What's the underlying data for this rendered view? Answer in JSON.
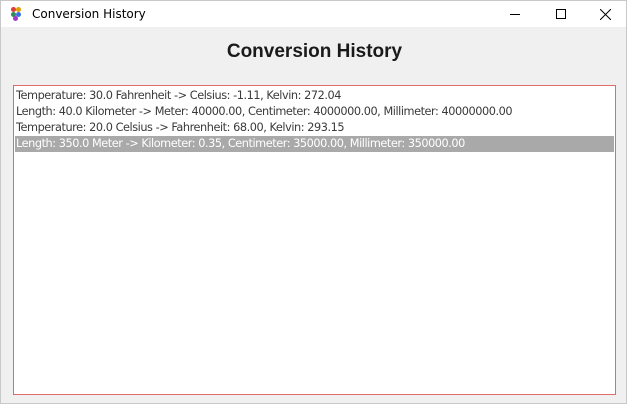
{
  "window": {
    "title": "Conversion History",
    "controls": {
      "minimize_icon": "minimize-icon",
      "maximize_icon": "maximize-icon",
      "close_icon": "close-icon"
    }
  },
  "heading": "Conversion History",
  "history": {
    "items": [
      "Temperature: 30.0 Fahrenheit -> Celsius: -1.11, Kelvin: 272.04",
      "Length: 40.0 Kilometer -> Meter: 40000.00, Centimeter: 4000000.00, Millimeter: 40000000.00",
      "Temperature: 20.0 Celsius -> Fahrenheit: 68.00, Kelvin: 293.15",
      "Length: 350.0 Meter -> Kilometer: 0.35, Centimeter: 35000.00, Millimeter: 350000.00"
    ],
    "selected_index": 3
  },
  "colors": {
    "list_border": "#e06b6b",
    "selection_background": "#a9a9a9",
    "selection_text": "#ffffff"
  }
}
